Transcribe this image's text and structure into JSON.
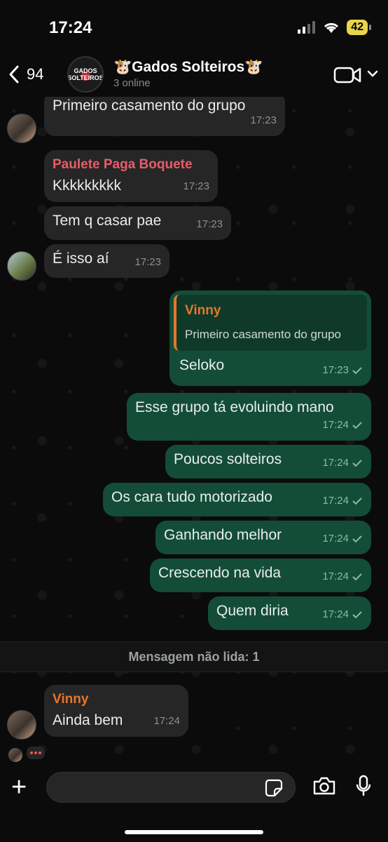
{
  "status_bar": {
    "time": "17:24",
    "battery": "42"
  },
  "header": {
    "back_count": "94",
    "title": "🐮Gados Solteiros🐮",
    "subtitle": "3 online",
    "avatar_text": "GADOS SOLTEIROS"
  },
  "messages": [
    {
      "text": "Primeiro casamento do grupo",
      "time": "17:23"
    },
    {
      "sender": "Paulete Paga Boquete",
      "text": "Kkkkkkkkk",
      "time": "17:23"
    },
    {
      "text": "Tem q casar pae",
      "time": "17:23"
    },
    {
      "text": "É isso aí",
      "time": "17:23"
    },
    {
      "quote_name": "Vinny",
      "quote_text": "Primeiro casamento do grupo",
      "text": "Seloko",
      "time": "17:23"
    },
    {
      "text": "Esse grupo tá evoluindo mano",
      "time": "17:24"
    },
    {
      "text": "Poucos solteiros",
      "time": "17:24"
    },
    {
      "text": "Os cara tudo motorizado",
      "time": "17:24"
    },
    {
      "text": "Ganhando melhor",
      "time": "17:24"
    },
    {
      "text": "Crescendo na vida",
      "time": "17:24"
    },
    {
      "text": "Quem diria",
      "time": "17:24"
    },
    {
      "sender": "Vinny",
      "text": "Ainda bem",
      "time": "17:24"
    }
  ],
  "unread_divider": "Mensagem não lida: 1",
  "composer": {
    "value": "",
    "placeholder": ""
  },
  "colors": {
    "incoming": "#262626",
    "outgoing": "#134d37",
    "sender_pink": "#e85c6a",
    "sender_orange": "#e4772d",
    "background": "#0b0b0b"
  }
}
